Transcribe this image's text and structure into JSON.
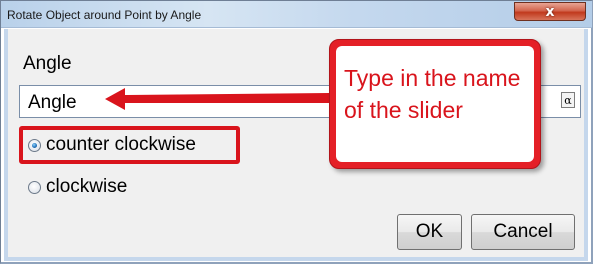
{
  "window": {
    "title": "Rotate Object around Point by Angle",
    "close_glyph": "x"
  },
  "form": {
    "angle_label": "Angle",
    "angle_value": "Angle",
    "symbol_button": "α"
  },
  "orientation": {
    "options": [
      {
        "label": "counter clockwise",
        "checked": true
      },
      {
        "label": "clockwise",
        "checked": false
      }
    ]
  },
  "buttons": {
    "ok": "OK",
    "cancel": "Cancel"
  },
  "annotation": {
    "callout_text": "Type in the name of the slider",
    "color": "#d9141c"
  }
}
